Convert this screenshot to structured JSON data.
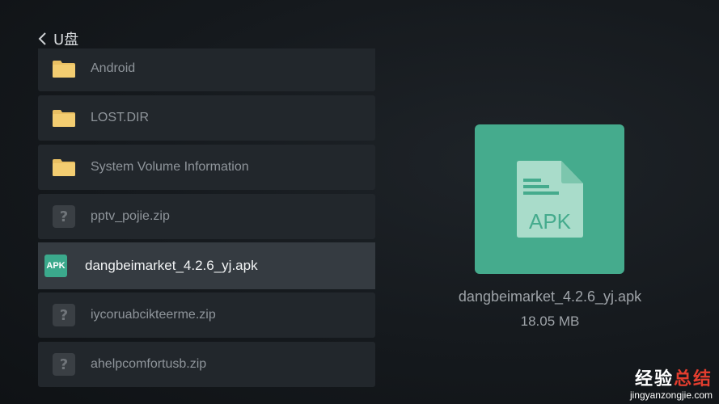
{
  "header": {
    "title": "U盘",
    "back_icon": "chevron-left-icon"
  },
  "files": [
    {
      "name": "Android",
      "icon": "folder-icon"
    },
    {
      "name": "LOST.DIR",
      "icon": "folder-icon"
    },
    {
      "name": "System Volume Information",
      "icon": "folder-icon"
    },
    {
      "name": "pptv_pojie.zip",
      "icon": "unknown-file-icon",
      "glyph": "?"
    },
    {
      "name": "dangbeimarket_4.2.6_yj.apk",
      "icon": "apk-icon",
      "glyph": "APK",
      "selected": true
    },
    {
      "name": "iycoruabcikteerme.zip",
      "icon": "unknown-file-icon",
      "glyph": "?"
    },
    {
      "name": "ahelpcomfortusb.zip",
      "icon": "unknown-file-icon",
      "glyph": "?"
    }
  ],
  "preview": {
    "badge_text": "APK",
    "file_name": "dangbeimarket_4.2.6_yj.apk",
    "file_size": "18.05 MB",
    "accent_color": "#45ab8d"
  },
  "watermark": {
    "title_part1": "经验",
    "title_part2": "总结",
    "url": "jingyanzongjie.com"
  }
}
